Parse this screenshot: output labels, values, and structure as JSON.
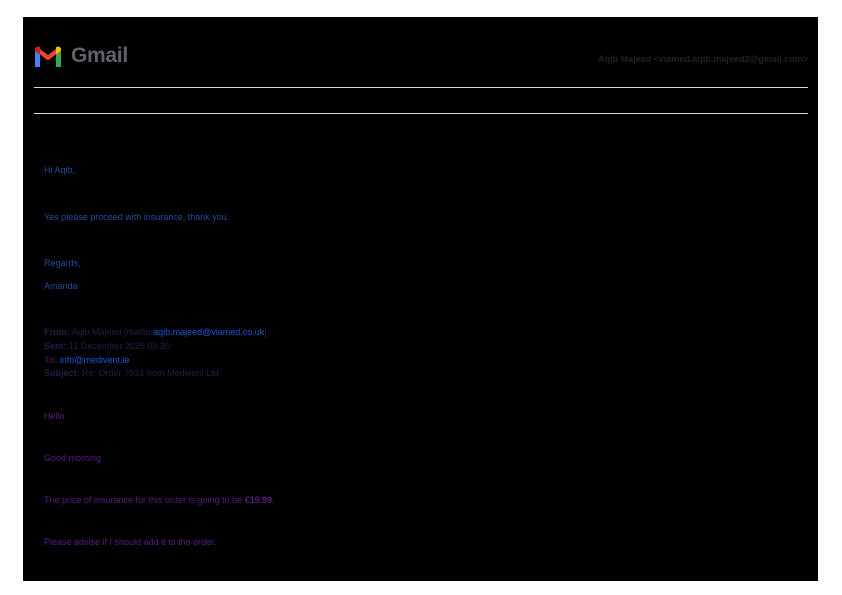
{
  "header": {
    "logo_text": "Gmail",
    "account": "Aqib Majeed <viamed.aqib.majeed2@gmail.com>"
  },
  "reply": {
    "greeting": "Hi Aqib,",
    "message": "Yes please proceed with insurance, thank you.",
    "signoff": "Regards,",
    "name": "Amanda"
  },
  "quoted_header": {
    "from_label": "From:",
    "from_name": "Aqib Majeed [mailto:",
    "from_email": "aqib.majeed@viamed.co.uk",
    "from_close": "]",
    "sent_label": "Sent:",
    "sent_value": "11 December 2025 09:35",
    "to_label": "To:",
    "to_value": "info@medivent.ie",
    "subject_label": "Subject:",
    "subject_value": "Re: Order 7933 from Medivent Ltd"
  },
  "quoted_body": {
    "hello": "Hello",
    "good_morning": "Good morning",
    "price_text": "The price of insurance for this order is going to be ",
    "price_value": "€19.99.",
    "advise": "Please advise if I should add it to the order."
  },
  "colors": {
    "background": "#000000",
    "reply_text": "#1f4e9c",
    "quoted_text": "#5b1b7e",
    "link": "#1a56db"
  }
}
